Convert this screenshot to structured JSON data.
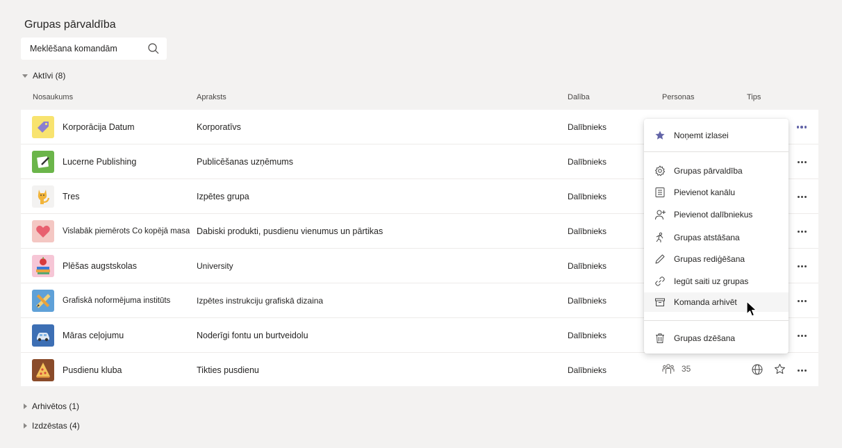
{
  "page": {
    "title": "Grupas pārvaldība",
    "search_placeholder": "Meklēšana komandām"
  },
  "sections": {
    "active": "Aktīvi (8)",
    "archived": "Arhivētos (1)",
    "deleted": "Izdzēstas (4)"
  },
  "columns": {
    "name": "Nosaukums",
    "description": "Apraksts",
    "membership": "Dalība",
    "people": "Personas",
    "type": "Tips"
  },
  "teams": [
    {
      "name": "Korporācija Datum",
      "description": "Korporatīvs",
      "role": "Dalībnieks",
      "avatar_bg": "#f8e36f",
      "icon": "tag-icon"
    },
    {
      "name": "Lucerne Publishing",
      "description": "Publicēšanas uzņēmums",
      "role": "Dalībnieks",
      "avatar_bg": "#6bb54a",
      "icon": "paper-pen-icon"
    },
    {
      "name": "Tres",
      "description": "Izpētes grupa",
      "role": "Dalībnieks",
      "avatar_bg": "#f3f2f1",
      "icon": "cat-icon"
    },
    {
      "name": "Vislabāk piemērots Co kopējā masa",
      "description": "Dabiski produkti, pusdienu vienumus un pārtikas",
      "role": "Dalībnieks",
      "avatar_bg": "#f4c7c3",
      "icon": "heart-icon"
    },
    {
      "name": "Plēšas augstskolas",
      "description": "University",
      "role": "Dalībnieks",
      "avatar_bg": "#f6c6d6",
      "icon": "apple-books-icon"
    },
    {
      "name": "Grafiskā noformējuma institūts",
      "description": "Izpētes instrukciju grafiskā dizaina",
      "role": "Dalībnieks",
      "avatar_bg": "#5fa1d8",
      "icon": "pencil-ruler-icon"
    },
    {
      "name": "Māras ceļojumu",
      "description": "Noderīgi fontu un burtveidolu",
      "role": "Dalībnieks",
      "avatar_bg": "#3d6fb4",
      "icon": "car-icon"
    },
    {
      "name": "Pusdienu kluba",
      "description": "Tikties pusdienu",
      "role": "Dalībnieks",
      "avatar_bg": "#8a4b2a",
      "icon": "pizza-icon",
      "people_count": "35"
    }
  ],
  "context_menu": {
    "remove_favorite": "Noņemt izlasei",
    "manage_team": "Grupas pārvaldība",
    "add_channel": "Pievienot kanālu",
    "add_members": "Pievienot dalībniekus",
    "leave_team": "Grupas atstāšana",
    "edit_team": "Grupas rediģēšana",
    "get_link": "Iegūt saiti uz grupas",
    "archive_team": "Komanda arhivēt",
    "delete_team": "Grupas dzēšana"
  },
  "colors": {
    "accent": "#6264a7",
    "background": "#f3f2f1"
  }
}
